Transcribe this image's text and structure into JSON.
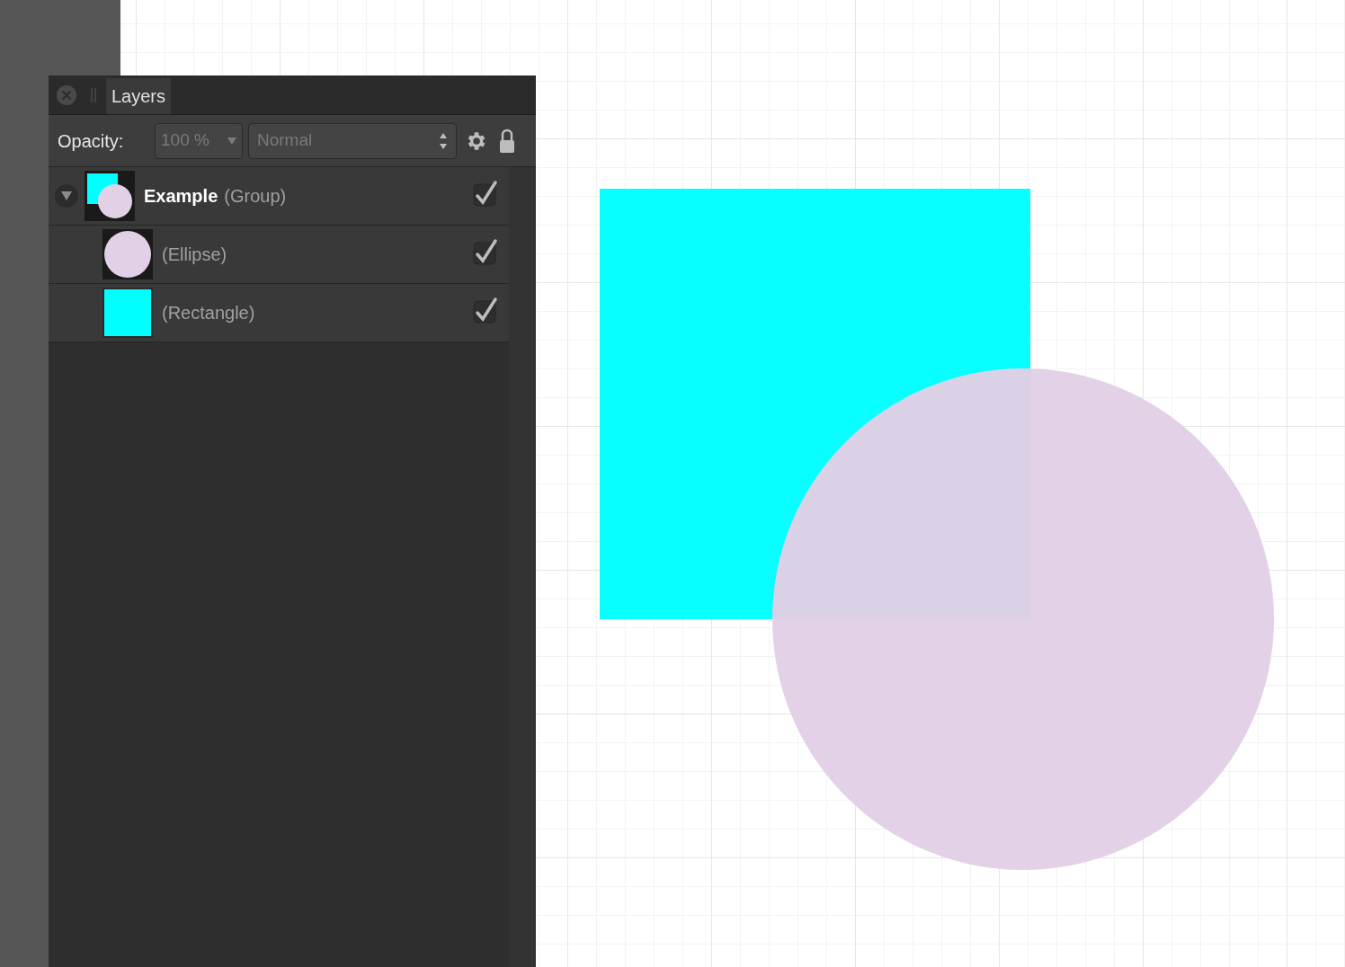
{
  "panel": {
    "tab": "Layers",
    "opacity_label": "Opacity:",
    "opacity_value": "100 %",
    "blend_mode": "Normal"
  },
  "layers": [
    {
      "kind": "group",
      "name": "Example",
      "type": "(Group)",
      "expanded": true,
      "visible": true,
      "children": [
        {
          "kind": "ellipse",
          "type": "(Ellipse)",
          "visible": true
        },
        {
          "kind": "rectangle",
          "type": "(Rectangle)",
          "visible": true
        }
      ]
    }
  ]
}
